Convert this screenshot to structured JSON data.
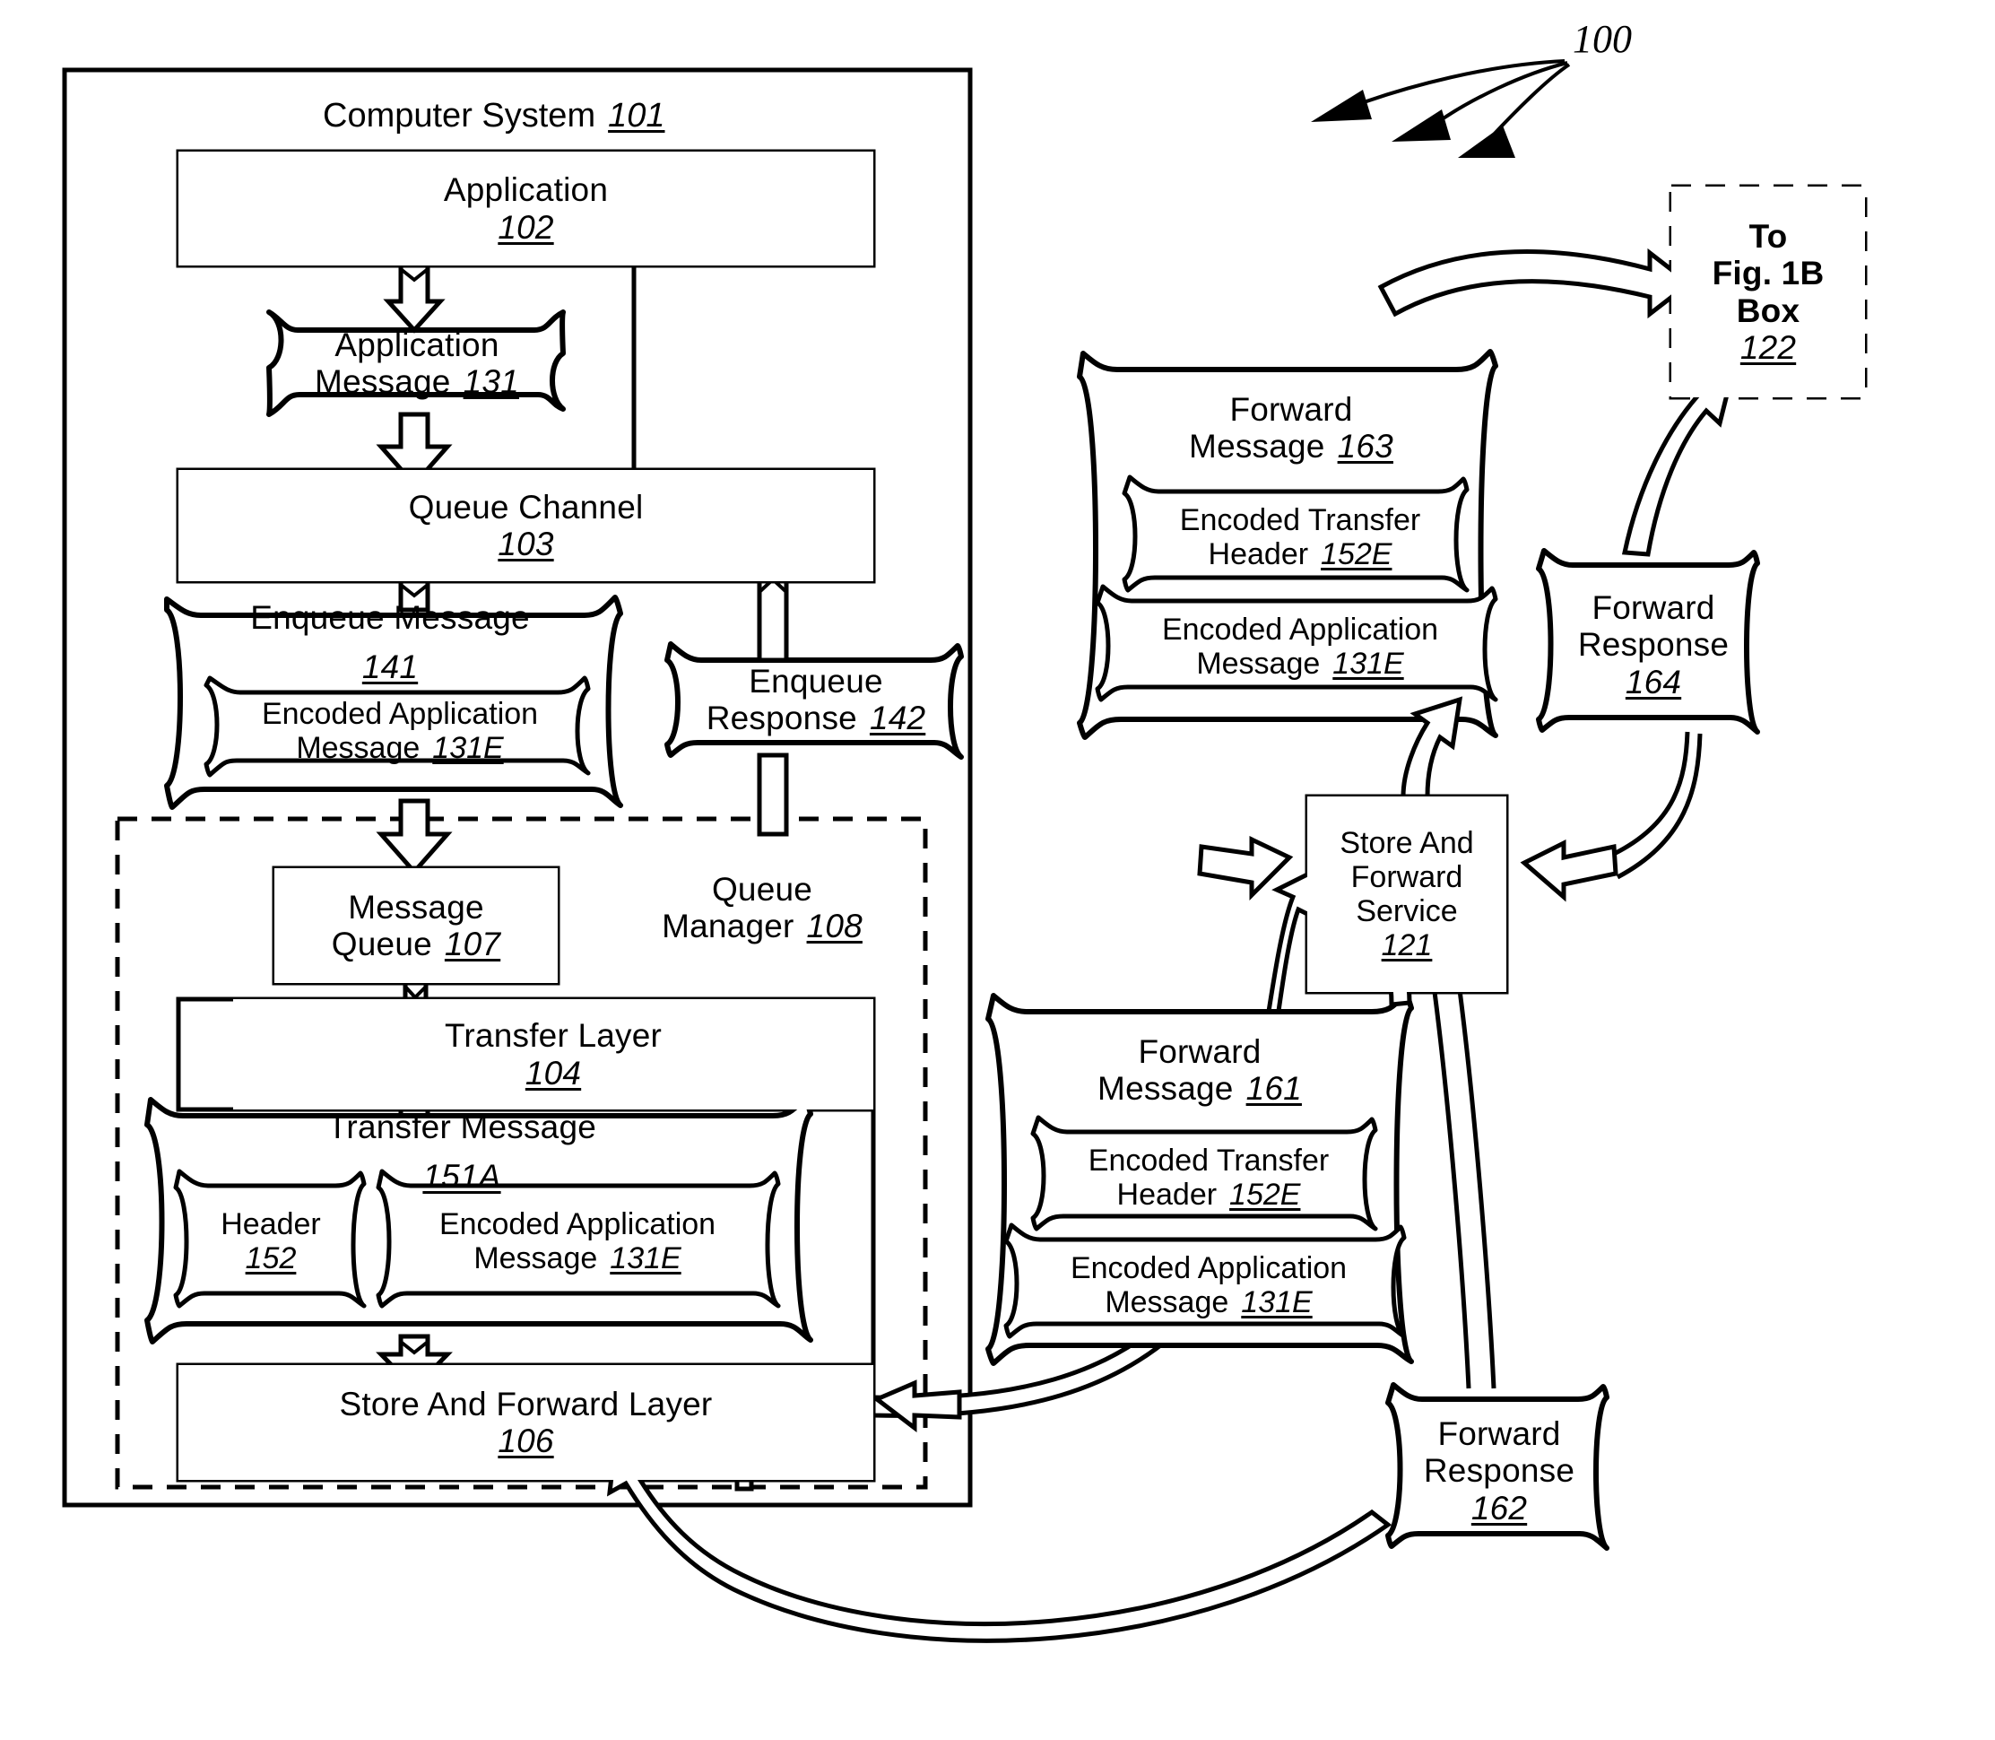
{
  "figure": {
    "ref_label": "100",
    "title_text": "Computer System",
    "title_num": "101"
  },
  "computer_system": {
    "label": "Computer System",
    "num": "101",
    "application": {
      "label": "Application",
      "num": "102"
    },
    "application_message": {
      "label": "Application",
      "label2": "Message",
      "num": "131"
    },
    "queue_channel": {
      "label": "Queue Channel",
      "num": "103"
    },
    "enqueue_message": {
      "label": "Enqueue Message",
      "num": "141",
      "inner": {
        "label": "Encoded Application",
        "label2": "Message",
        "num": "131E"
      }
    },
    "enqueue_response": {
      "label": "Enqueue",
      "label2": "Response",
      "num": "142"
    },
    "queue_manager": {
      "label": "Queue",
      "label2": "Manager",
      "num": "108"
    },
    "message_queue": {
      "label": "Message",
      "label2": "Queue",
      "num": "107"
    },
    "transfer_layer": {
      "label": "Transfer Layer",
      "num": "104"
    },
    "transfer_message": {
      "label": "Transfer Message",
      "num": "151A",
      "header": {
        "label": "Header",
        "num": "152"
      },
      "encoded_app_message": {
        "label": "Encoded Application",
        "label2": "Message",
        "num": "131E"
      }
    },
    "store_and_forward_layer": {
      "label": "Store And Forward Layer",
      "num": "106"
    }
  },
  "right_side": {
    "forward_message_163": {
      "label": "Forward",
      "label2": "Message",
      "num": "163",
      "encoded_transfer_header": {
        "label": "Encoded Transfer",
        "label2": "Header",
        "num": "152E"
      },
      "encoded_app_message": {
        "label": "Encoded Application",
        "label2": "Message",
        "num": "131E"
      }
    },
    "forward_response_164": {
      "label": "Forward",
      "label2": "Response",
      "num": "164"
    },
    "to_fig_1b_box": {
      "label": "To",
      "label2": "Fig. 1B",
      "label3": "Box",
      "num": "122"
    },
    "store_and_forward_service": {
      "label": "Store And",
      "label2": "Forward",
      "label3": "Service",
      "num": "121"
    },
    "forward_message_161": {
      "label": "Forward",
      "label2": "Message",
      "num": "161",
      "encoded_transfer_header": {
        "label": "Encoded Transfer",
        "label2": "Header",
        "num": "152E"
      },
      "encoded_app_message": {
        "label": "Encoded Application",
        "label2": "Message",
        "num": "131E"
      }
    },
    "forward_response_162": {
      "label": "Forward",
      "label2": "Response",
      "num": "162"
    }
  }
}
